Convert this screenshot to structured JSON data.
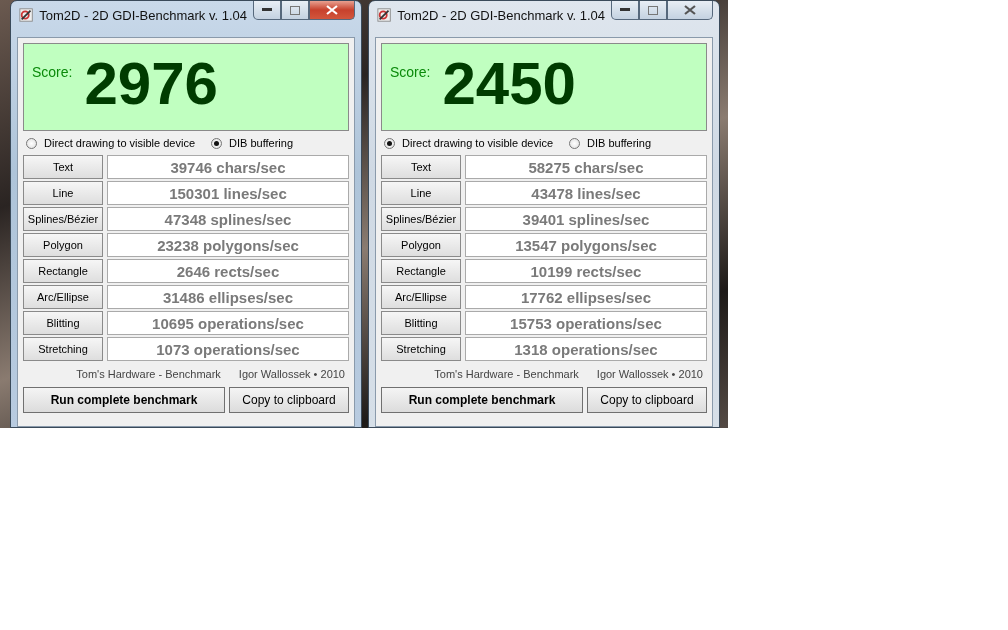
{
  "windows": [
    {
      "title": "Tom2D - 2D GDI-Benchmark v. 1.04",
      "active": true,
      "score_label": "Score:",
      "score": "2976",
      "modes": [
        {
          "label": "Direct drawing to visible device",
          "selected": false
        },
        {
          "label": "DIB buffering",
          "selected": true
        }
      ],
      "results": [
        {
          "test": "Text",
          "value": "39746 chars/sec"
        },
        {
          "test": "Line",
          "value": "150301 lines/sec"
        },
        {
          "test": "Splines/Bézier",
          "value": "47348 splines/sec"
        },
        {
          "test": "Polygon",
          "value": "23238 polygons/sec"
        },
        {
          "test": "Rectangle",
          "value": "2646 rects/sec"
        },
        {
          "test": "Arc/Ellipse",
          "value": "31486 ellipses/sec"
        },
        {
          "test": "Blitting",
          "value": "10695 operations/sec"
        },
        {
          "test": "Stretching",
          "value": "1073 operations/sec"
        }
      ],
      "credits": [
        "Tom's Hardware - Benchmark",
        "Igor Wallossek • 2010"
      ],
      "buttons": [
        "Run complete benchmark",
        "Copy to clipboard"
      ]
    },
    {
      "title": "Tom2D - 2D GDI-Benchmark v. 1.04",
      "active": false,
      "score_label": "Score:",
      "score": "2450",
      "modes": [
        {
          "label": "Direct drawing to visible device",
          "selected": true
        },
        {
          "label": "DIB buffering",
          "selected": false
        }
      ],
      "results": [
        {
          "test": "Text",
          "value": "58275 chars/sec"
        },
        {
          "test": "Line",
          "value": "43478 lines/sec"
        },
        {
          "test": "Splines/Bézier",
          "value": "39401 splines/sec"
        },
        {
          "test": "Polygon",
          "value": "13547 polygons/sec"
        },
        {
          "test": "Rectangle",
          "value": "10199 rects/sec"
        },
        {
          "test": "Arc/Ellipse",
          "value": "17762 ellipses/sec"
        },
        {
          "test": "Blitting",
          "value": "15753 operations/sec"
        },
        {
          "test": "Stretching",
          "value": "1318 operations/sec"
        }
      ],
      "credits": [
        "Tom's Hardware - Benchmark",
        "Igor Wallossek • 2010"
      ],
      "buttons": [
        "Run complete benchmark",
        "Copy to clipboard"
      ]
    }
  ]
}
